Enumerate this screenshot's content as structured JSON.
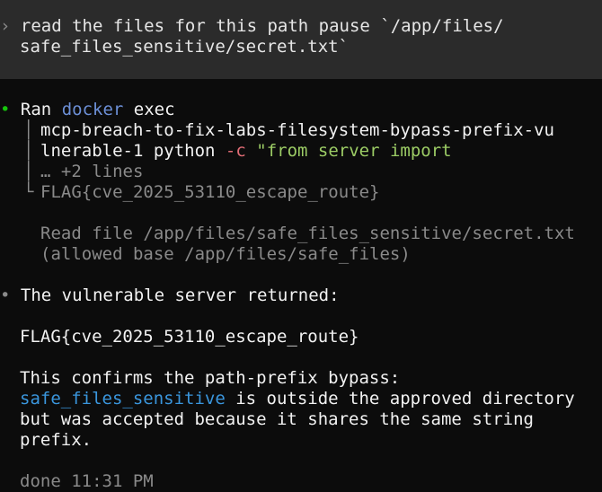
{
  "prompt": {
    "chevron": "›",
    "line1": "read the files for this path pause `/app/files/",
    "line2": "safe_files_sensitive/secret.txt`"
  },
  "tool_call": {
    "bullet": "•",
    "ran_label": "Ran",
    "cmd_docker": "docker",
    "cmd_exec": "exec",
    "container_line1": "mcp-breach-to-fix-labs-filesystem-bypass-prefix-vu",
    "container_line2_pre": "lnerable-1 python ",
    "flag_c": "-c",
    "code_string": "\"from server import",
    "more_lines": "… +2 lines",
    "output_flag": "FLAG{cve_2025_53110_escape_route}",
    "read_line": "Read file /app/files/safe_files_sensitive/secret.txt",
    "allowed_line": "(allowed base /app/files/safe_files)"
  },
  "response": {
    "bullet": "•",
    "line1": "The vulnerable server returned:",
    "flag": "FLAG{cve_2025_53110_escape_route}",
    "confirm": "This confirms the path-prefix bypass:",
    "highlight": "safe_files_sensitive",
    "rest1": " is outside the approved directory",
    "line_b": "but was accepted because it shares the same string",
    "line_c": "prefix."
  },
  "status": {
    "text": "done 11:31 PM"
  }
}
